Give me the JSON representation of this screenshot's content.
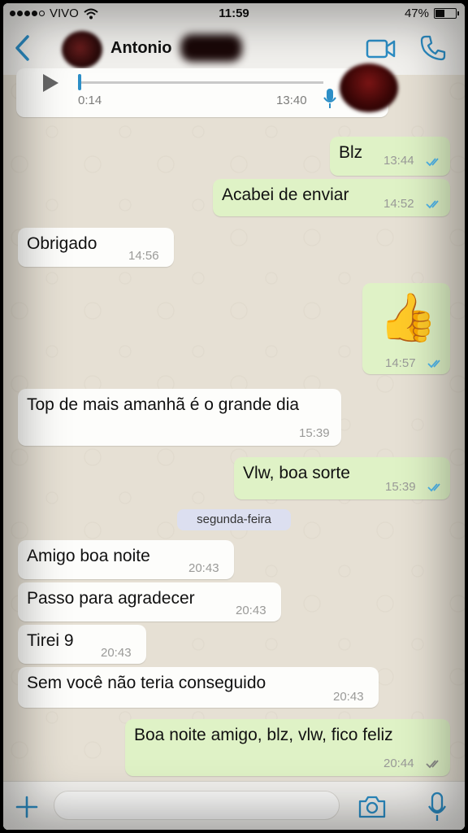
{
  "status_bar": {
    "carrier": "VIVO",
    "time": "11:59",
    "battery": "47%"
  },
  "header": {
    "contact_name": "Antonio"
  },
  "audio_message": {
    "duration": "0:14",
    "time": "13:40"
  },
  "messages": [
    {
      "dir": "out",
      "text": "Blz",
      "time": "13:44",
      "ticks": true
    },
    {
      "dir": "out",
      "text": "Acabei de enviar",
      "time": "14:52",
      "ticks": true
    },
    {
      "dir": "in",
      "text": "Obrigado",
      "time": "14:56"
    },
    {
      "dir": "out",
      "text": "👍",
      "time": "14:57",
      "ticks": true
    },
    {
      "dir": "in",
      "text": "Top de mais amanhã é o grande dia",
      "time": "15:39"
    },
    {
      "dir": "out",
      "text": "Vlw, boa sorte",
      "time": "15:39",
      "ticks": true
    },
    {
      "dir": "in",
      "text": "Amigo boa noite",
      "time": "20:43"
    },
    {
      "dir": "in",
      "text": "Passo para agradecer",
      "time": "20:43"
    },
    {
      "dir": "in",
      "text": "Tirei 9",
      "time": "20:43"
    },
    {
      "dir": "in",
      "text": "Sem você não teria conseguido",
      "time": "20:43"
    },
    {
      "dir": "out",
      "text": "Boa noite amigo, blz, vlw, fico feliz",
      "time": "20:44",
      "ticks": true,
      "read_grey": true
    }
  ],
  "date_separator": "segunda-feira",
  "input": {
    "placeholder": ""
  },
  "colors": {
    "accent": "#2c8ec6",
    "outgoing_bubble": "#dff2c6",
    "incoming_bubble": "#fdfdfb",
    "read_ticks": "#4fb6ec"
  },
  "icons": [
    "back-icon",
    "video-call-icon",
    "phone-icon",
    "play-icon",
    "mic-icon",
    "plus-icon",
    "camera-icon",
    "wifi-icon"
  ]
}
